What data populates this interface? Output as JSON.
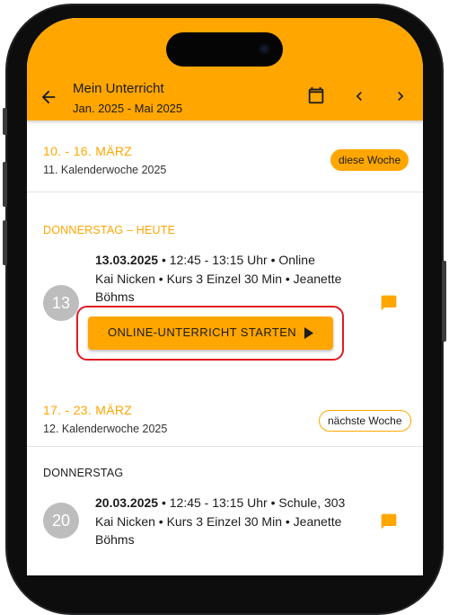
{
  "appbar": {
    "title": "Mein Unterricht",
    "subtitle": "Jan. 2025 - Mai 2025",
    "back_icon": "arrow-back-icon",
    "calendar_icon": "calendar-icon",
    "prev_icon": "chevron-left-icon",
    "next_icon": "chevron-right-icon"
  },
  "weeks": [
    {
      "title": "10. - 16. MÄRZ",
      "subtitle": "11. Kalenderwoche 2025",
      "chip": "diese Woche",
      "day_label": "DONNERSTAG – HEUTE",
      "lesson": {
        "day_number": "13",
        "date": "13.03.2025",
        "details": " • 12:45 - 13:15 Uhr • Online",
        "line2": "Kai Nicken • Kurs 3 Einzel 30 Min • Jeanette",
        "line3": "Böhms"
      },
      "start_button": "ONLINE-UNTERRICHT STARTEN"
    },
    {
      "title": "17. - 23. MÄRZ",
      "subtitle": "12. Kalenderwoche 2025",
      "chip": "nächste Woche",
      "day_label": "DONNERSTAG",
      "lesson": {
        "day_number": "20",
        "date": "20.03.2025",
        "details": " • 12:45 - 13:15 Uhr • Schule, 303",
        "line2": "Kai Nicken • Kurs 3 Einzel 30 Min • Jeanette",
        "line3": "Böhms"
      }
    }
  ],
  "colors": {
    "accent": "#ffa600",
    "highlight": "#e01b24",
    "circle": "#bdbdbd"
  }
}
